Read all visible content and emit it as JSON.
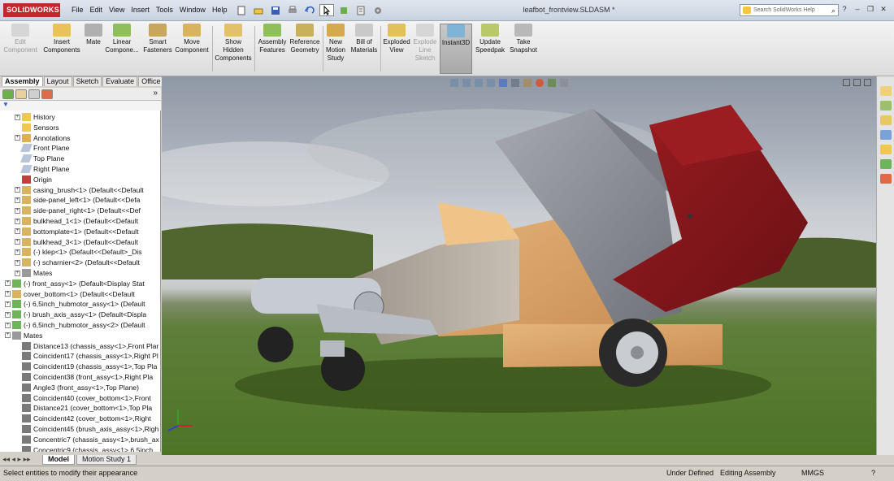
{
  "app": {
    "brand": "SOLIDWORKS",
    "doc_title": "leafbot_frontview.SLDASM *"
  },
  "menus": [
    "File",
    "Edit",
    "View",
    "Insert",
    "Tools",
    "Window",
    "Help"
  ],
  "help_search": {
    "placeholder": "Search SolidWorks Help"
  },
  "ribbon": [
    {
      "label": "Edit Component",
      "disabled": true
    },
    {
      "label": "Insert Components",
      "disabled": false
    },
    {
      "label": "Mate",
      "disabled": false
    },
    {
      "label": "Linear Compone...",
      "disabled": false
    },
    {
      "label": "Smart Fasteners",
      "disabled": false
    },
    {
      "label": "Move Component",
      "disabled": false
    },
    {
      "label": "Show Hidden Components",
      "disabled": false
    },
    {
      "label": "Assembly Features",
      "disabled": false
    },
    {
      "label": "Reference Geometry",
      "disabled": false
    },
    {
      "label": "New Motion Study",
      "disabled": false
    },
    {
      "label": "Bill of Materials",
      "disabled": false
    },
    {
      "label": "Exploded View",
      "disabled": false
    },
    {
      "label": "Explode Line Sketch",
      "disabled": true
    },
    {
      "label": "Instant3D",
      "disabled": false,
      "active": true
    },
    {
      "label": "Update Speedpak",
      "disabled": false
    },
    {
      "label": "Take Snapshot",
      "disabled": false
    }
  ],
  "command_tabs": [
    "Assembly",
    "Layout",
    "Sketch",
    "Evaluate",
    "Office Products"
  ],
  "feature_tree": [
    {
      "label": "History",
      "indent": 1,
      "icon": "folder",
      "expander": true
    },
    {
      "label": "Sensors",
      "indent": 1,
      "icon": "folder",
      "expander": false
    },
    {
      "label": "Annotations",
      "indent": 1,
      "icon": "annotation",
      "expander": true
    },
    {
      "label": "Front Plane",
      "indent": 1,
      "icon": "plane",
      "expander": false
    },
    {
      "label": "Top Plane",
      "indent": 1,
      "icon": "plane",
      "expander": false
    },
    {
      "label": "Right Plane",
      "indent": 1,
      "icon": "plane",
      "expander": false
    },
    {
      "label": "Origin",
      "indent": 1,
      "icon": "origin",
      "expander": false
    },
    {
      "label": "casing_brush<1> (Default<<Default",
      "indent": 1,
      "icon": "part",
      "expander": true
    },
    {
      "label": "side-panel_left<1> (Default<<Defa",
      "indent": 1,
      "icon": "part",
      "expander": true
    },
    {
      "label": "side-panel_right<1> (Default<<Def",
      "indent": 1,
      "icon": "part",
      "expander": true
    },
    {
      "label": "bulkhead_1<1> (Default<<Default",
      "indent": 1,
      "icon": "part",
      "expander": true
    },
    {
      "label": "bottomplate<1> (Default<<Default",
      "indent": 1,
      "icon": "part",
      "expander": true
    },
    {
      "label": "bulkhead_3<1> (Default<<Default",
      "indent": 1,
      "icon": "part",
      "expander": true
    },
    {
      "label": "(-) klep<1> (Default<<Default>_Dis",
      "indent": 1,
      "icon": "part",
      "expander": true
    },
    {
      "label": "(-) scharnier<2> (Default<<Default",
      "indent": 1,
      "icon": "part",
      "expander": true
    },
    {
      "label": "Mates",
      "indent": 1,
      "icon": "mates",
      "expander": true
    },
    {
      "label": "(-) front_assy<1> (Default<Display Stat",
      "indent": 0,
      "icon": "assy",
      "expander": true
    },
    {
      "label": "cover_bottom<1> (Default<<Default",
      "indent": 0,
      "icon": "part",
      "expander": true
    },
    {
      "label": "(-) 6,5inch_hubmotor_assy<1> (Default",
      "indent": 0,
      "icon": "assy",
      "expander": true
    },
    {
      "label": "(-) brush_axis_assy<1> (Default<Displa",
      "indent": 0,
      "icon": "assy",
      "expander": true
    },
    {
      "label": "(-) 6,5inch_hubmotor_assy<2> (Default",
      "indent": 0,
      "icon": "assy",
      "expander": true
    },
    {
      "label": "Mates",
      "indent": 0,
      "icon": "mates",
      "expander": true
    },
    {
      "label": "Distance13 (chassis_assy<1>,Front Plar",
      "indent": 1,
      "icon": "mate",
      "expander": false
    },
    {
      "label": "Coincident17 (chassis_assy<1>,Right Pl",
      "indent": 1,
      "icon": "mate",
      "expander": false
    },
    {
      "label": "Coincident19 (chassis_assy<1>,Top Pla",
      "indent": 1,
      "icon": "mate",
      "expander": false
    },
    {
      "label": "Coincident38 (front_assy<1>,Right Pla",
      "indent": 1,
      "icon": "mate",
      "expander": false
    },
    {
      "label": "Angle3 (front_assy<1>,Top Plane)",
      "indent": 1,
      "icon": "mate",
      "expander": false
    },
    {
      "label": "Coincident40 (cover_bottom<1>,Front",
      "indent": 1,
      "icon": "mate",
      "expander": false
    },
    {
      "label": "Distance21 (cover_bottom<1>,Top Pla",
      "indent": 1,
      "icon": "mate",
      "expander": false
    },
    {
      "label": "Coincident42 (cover_bottom<1>,Right",
      "indent": 1,
      "icon": "mate",
      "expander": false
    },
    {
      "label": "Coincident45 (brush_axis_assy<1>,Righ",
      "indent": 1,
      "icon": "mate",
      "expander": false
    },
    {
      "label": "Concentric7 (chassis_assy<1>,brush_ax",
      "indent": 1,
      "icon": "mate",
      "expander": false
    },
    {
      "label": "Concentric9 (chassis_assy<1>,6,5inch",
      "indent": 1,
      "icon": "mate",
      "expander": false
    }
  ],
  "bottom_tabs": [
    "Model",
    "Motion Study 1"
  ],
  "status": {
    "left": "Select entities to modify their appearance",
    "definition": "Under Defined",
    "mode": "Editing Assembly",
    "units": "MMGS"
  },
  "colors": {
    "red_body": "#7d1518",
    "grey_body": "#8e9298",
    "wood": "#d9a46a",
    "title_red": "#c0282d"
  }
}
